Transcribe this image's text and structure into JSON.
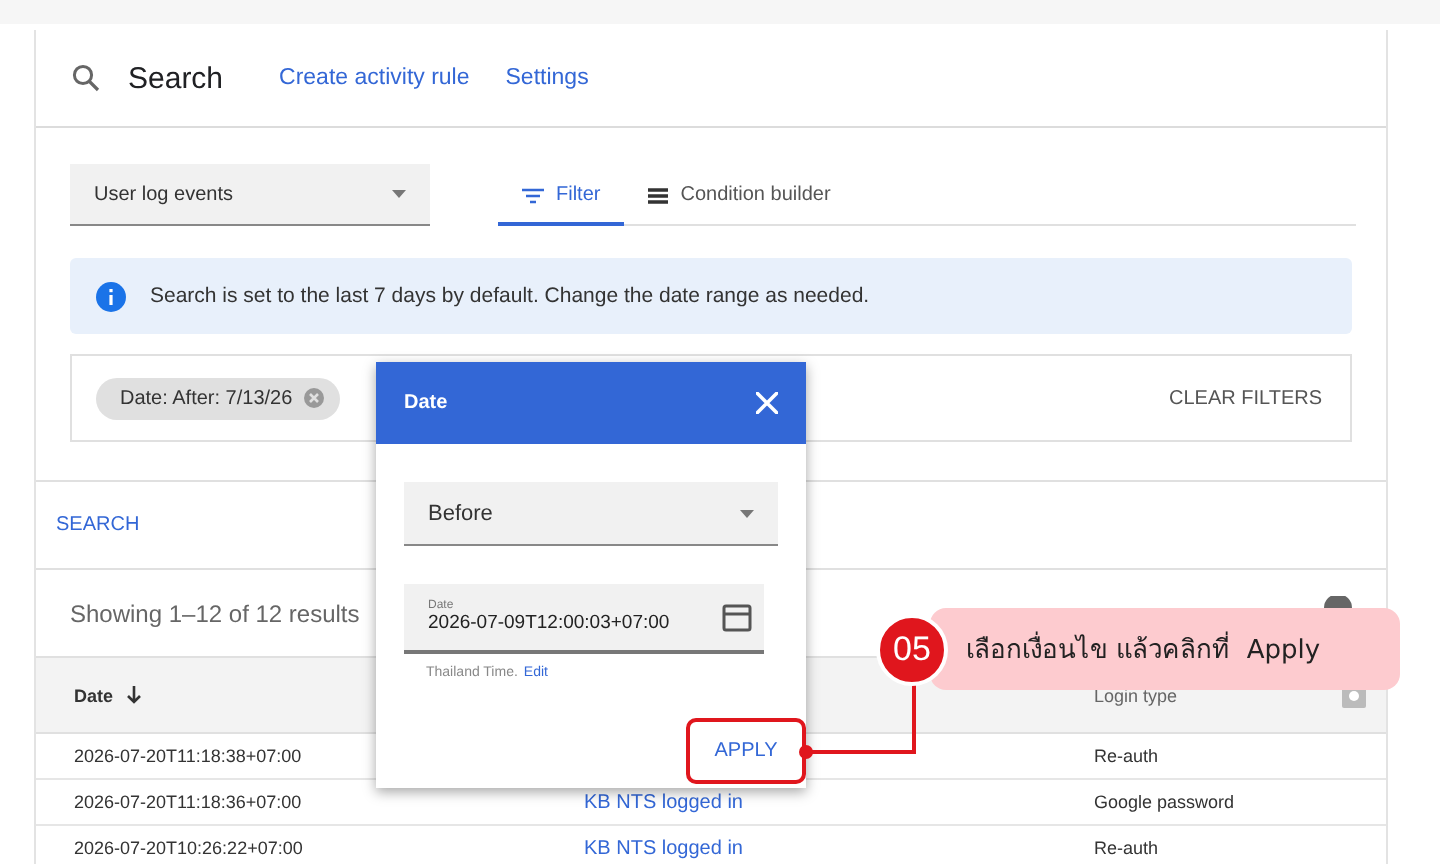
{
  "header": {
    "title": "Search",
    "links": [
      "Create activity rule",
      "Settings"
    ]
  },
  "source_select": {
    "value": "User log events"
  },
  "tabs": [
    {
      "label": "Filter",
      "kind": "filter",
      "selected": true
    },
    {
      "label": "Condition builder",
      "kind": "builder",
      "selected": false
    }
  ],
  "banner": {
    "text": "Search is set to the last 7 days by default. Change the date range as needed."
  },
  "filter_chip": {
    "label": "Date: After: 7/13/26"
  },
  "clear_filters": "CLEAR FILTERS",
  "search_button": "SEARCH",
  "results_summary": "Showing 1–12 of 12 results",
  "table": {
    "columns": [
      {
        "label": "Date",
        "sorted": true
      },
      {
        "label": "Login type",
        "sorted": false
      }
    ],
    "rows": [
      {
        "date": "2026-07-20T11:18:38+07:00",
        "login_type": "Re-auth"
      },
      {
        "date": "2026-07-20T11:18:36+07:00",
        "column_3": "KB NTS logged in",
        "login_type": "Google password"
      },
      {
        "date": "2026-07-20T10:26:22+07:00",
        "column_3": "KB NTS logged in",
        "login_type": "Re-auth"
      }
    ]
  },
  "date_dialog": {
    "title": "Date",
    "operator": "Before",
    "date_label": "Date",
    "date_value": "2026-07-09T12:00:03+07:00",
    "helper": "Thailand Time.",
    "helper_link": "Edit",
    "apply": "APPLY"
  },
  "callout": {
    "step": "05",
    "text": "เลือกเงื่อนไข แล้วคลิกที่  Apply"
  }
}
